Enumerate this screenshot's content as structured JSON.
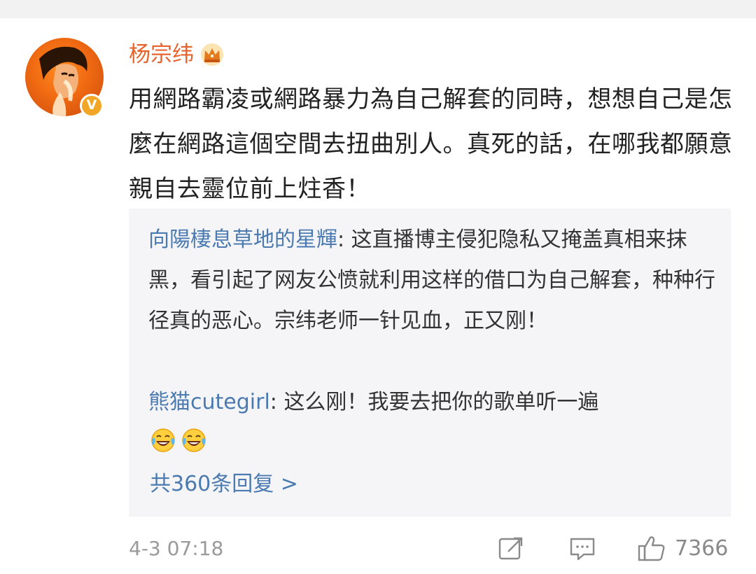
{
  "comment": {
    "username": "杨宗纬",
    "badges": {
      "vip": "crown-icon",
      "verified": "V"
    },
    "text": "用網路霸凌或網路暴力為自己解套的同時，想想自己是怎麼在網路這個空間去扭曲別人。真死的話，在哪我都願意親自去靈位前上炷香！",
    "replies": [
      {
        "author": "向陽棲息草地的星輝",
        "separator": ": ",
        "text": "这直播博主侵犯隐私又掩盖真相来抹黑，看引起了网友公愤就利用这样的借口为自己解套，种种行径真的恶心。宗纬老师一针见血，正又刚！"
      },
      {
        "author": "熊猫cutegirl",
        "separator": ": ",
        "text": "这么刚！我要去把你的歌单听一遍",
        "emojis": [
          "laugh-cry-icon",
          "laugh-cry-icon"
        ]
      }
    ],
    "more_replies": "共360条回复 >",
    "timestamp": "4-3 07:18",
    "actions": {
      "repost_icon": "repost-icon",
      "comment_icon": "comment-icon",
      "like_icon": "thumbs-up-icon",
      "like_count": "7366"
    }
  },
  "colors": {
    "username": "#e8632c",
    "reply_author": "#4a7ab0",
    "reply_background": "#f5f5f7",
    "text": "#222222",
    "muted": "#9a9a9a"
  }
}
